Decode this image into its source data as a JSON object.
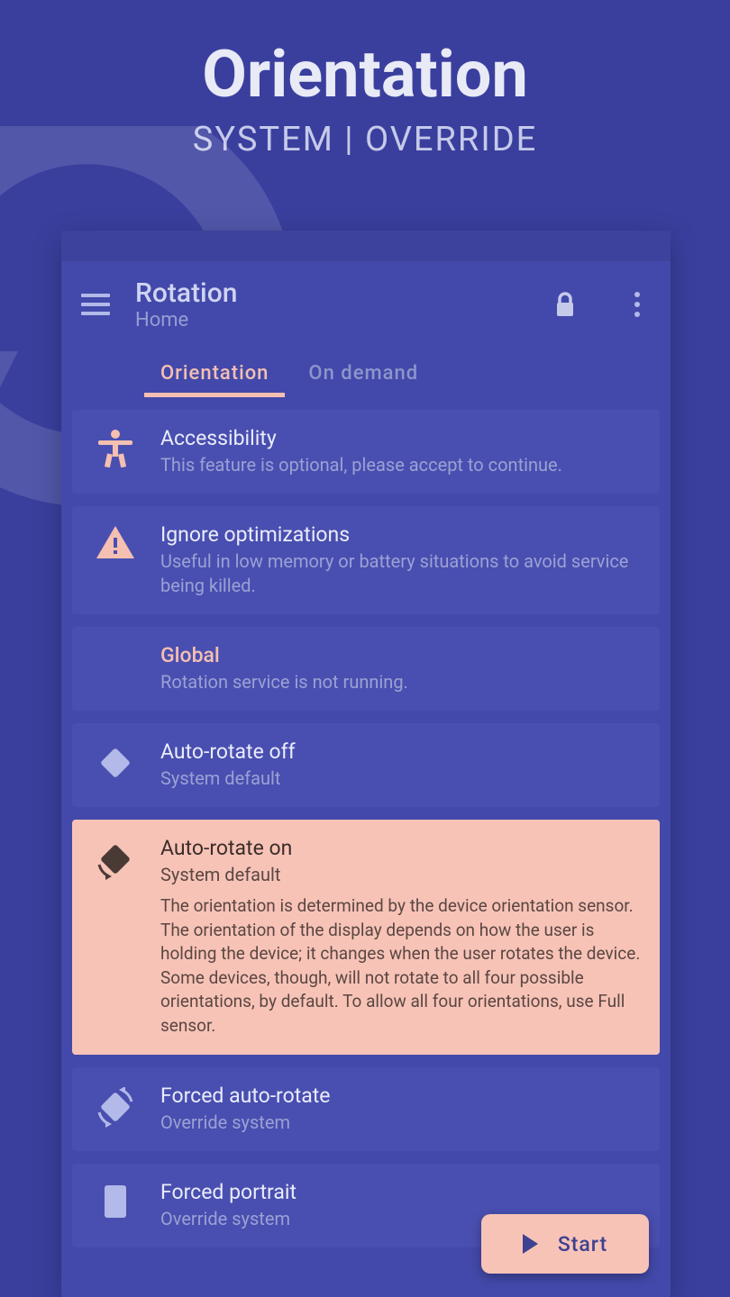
{
  "hero": {
    "title": "Orientation",
    "subtitle": "SYSTEM | OVERRIDE"
  },
  "app": {
    "title": "Rotation",
    "subtitle": "Home"
  },
  "tabs": {
    "orientation": "Orientation",
    "on_demand": "On demand"
  },
  "items": {
    "accessibility": {
      "title": "Accessibility",
      "desc": "This feature is optional, please accept to continue."
    },
    "ignore_opt": {
      "title": "Ignore optimizations",
      "desc": "Useful in low memory or battery situations to avoid service being killed."
    },
    "global": {
      "title": "Global",
      "desc": "Rotation service is not running."
    },
    "auto_off": {
      "title": "Auto-rotate off",
      "desc": "System default"
    },
    "auto_on": {
      "title": "Auto-rotate on",
      "desc": "System default",
      "detail": "The orientation is determined by the device orientation sensor. The orientation of the display depends on how the user is holding the device; it changes when the user rotates the device. Some devices, though, will not rotate to all four possible orientations, by default. To allow all four orientations, use Full sensor."
    },
    "forced_auto": {
      "title": "Forced auto-rotate",
      "desc": "Override system"
    },
    "forced_portrait": {
      "title": "Forced portrait",
      "desc": "Override system"
    }
  },
  "fab": {
    "label": "Start"
  }
}
